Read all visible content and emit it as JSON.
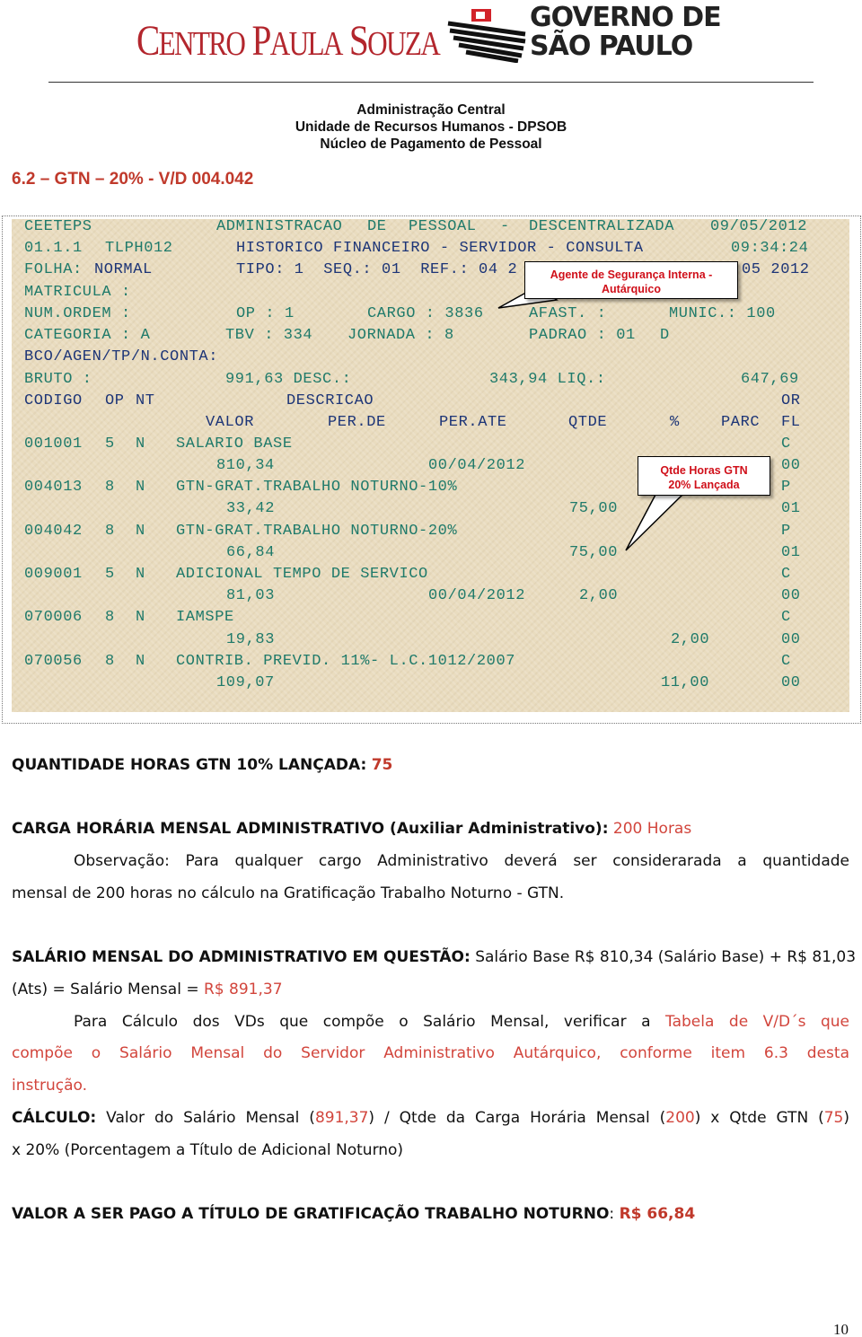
{
  "logos": {
    "left": "Centro Paula Souza",
    "right_line1": "GOVERNO DE",
    "right_line2": "SÃO PAULO"
  },
  "header": {
    "line1": "Administração Central",
    "line2": "Unidade de Recursos Humanos - DPSOB",
    "line3": "Núcleo de Pagamento de Pessoal"
  },
  "section_title": "6.2 – GTN – 20% - V/D 004.042",
  "terminal": {
    "rows": [
      [
        {
          "t": "CEETEPS",
          "c": "teal"
        },
        {
          "t": "ADMINISTRACAO",
          "c": "teal"
        },
        {
          "t": "DE",
          "c": "teal"
        },
        {
          "t": "PESSOAL",
          "c": "teal"
        },
        {
          "t": "-",
          "c": "teal"
        },
        {
          "t": "DESCENTRALIZADA",
          "c": "teal"
        },
        {
          "t": "09/05/2012",
          "c": "teal"
        }
      ],
      [
        {
          "t": "01.1.1",
          "c": "teal"
        },
        {
          "t": "TLPH012",
          "c": "teal"
        },
        {
          "t": "HISTORICO FINANCEIRO - SERVIDOR - CONSULTA",
          "c": "navy"
        },
        {
          "t": "09:34:24",
          "c": "teal"
        }
      ],
      [
        {
          "t": "FOLHA:",
          "c": "teal"
        },
        {
          "t": "NORMAL",
          "c": "navy"
        },
        {
          "t": "TIPO: 1  SEQ.: 01  REF.: 04 2",
          "c": "navy"
        },
        {
          "t": "05 2012",
          "c": "navy"
        }
      ],
      [
        {
          "t": "MATRICULA :",
          "c": "teal"
        }
      ],
      [
        {
          "t": "NUM.ORDEM :",
          "c": "teal"
        },
        {
          "t": "OP : 1",
          "c": "teal"
        },
        {
          "t": "CARGO : 3836",
          "c": "teal"
        },
        {
          "t": "AFAST. :",
          "c": "teal"
        },
        {
          "t": "MUNIC.: 100",
          "c": "teal"
        }
      ],
      [
        {
          "t": "CATEGORIA : A",
          "c": "teal"
        },
        {
          "t": "TBV : 334",
          "c": "teal"
        },
        {
          "t": "JORNADA : 8",
          "c": "teal"
        },
        {
          "t": "PADRAO : 01",
          "c": "teal"
        },
        {
          "t": "D",
          "c": "teal"
        }
      ],
      [
        {
          "t": "BCO/AGEN/TP/N.CONTA:",
          "c": "navy"
        }
      ],
      [
        {
          "t": "BRUTO :",
          "c": "teal"
        },
        {
          "t": "991,63 DESC.:",
          "c": "teal"
        },
        {
          "t": "343,94 LIQ.:",
          "c": "teal"
        },
        {
          "t": "647,69",
          "c": "teal"
        }
      ],
      [
        {
          "t": "CODIGO",
          "c": "navy"
        },
        {
          "t": "OP",
          "c": "navy"
        },
        {
          "t": "NT",
          "c": "navy"
        },
        {
          "t": "DESCRICAO",
          "c": "navy"
        },
        {
          "t": "OR",
          "c": "navy"
        }
      ],
      [
        {
          "t": "VALOR",
          "c": "navy"
        },
        {
          "t": "PER.DE",
          "c": "navy"
        },
        {
          "t": "PER.ATE",
          "c": "navy"
        },
        {
          "t": "QTDE",
          "c": "navy"
        },
        {
          "t": "%",
          "c": "navy"
        },
        {
          "t": "PARC",
          "c": "navy"
        },
        {
          "t": "FL",
          "c": "navy"
        }
      ],
      [
        {
          "t": "001001",
          "c": "teal"
        },
        {
          "t": "5",
          "c": "teal"
        },
        {
          "t": "N",
          "c": "teal"
        },
        {
          "t": "SALARIO BASE",
          "c": "teal"
        },
        {
          "t": "C",
          "c": "teal"
        }
      ],
      [
        {
          "t": "810,34",
          "c": "teal"
        },
        {
          "t": "00/04/2012",
          "c": "teal"
        },
        {
          "t": "00",
          "c": "teal"
        }
      ],
      [
        {
          "t": "004013",
          "c": "teal"
        },
        {
          "t": "8",
          "c": "teal"
        },
        {
          "t": "N",
          "c": "teal"
        },
        {
          "t": "GTN-GRAT.TRABALHO NOTURNO-10%",
          "c": "teal"
        },
        {
          "t": "P",
          "c": "teal"
        }
      ],
      [
        {
          "t": "33,42",
          "c": "teal"
        },
        {
          "t": "75,00",
          "c": "teal"
        },
        {
          "t": "01",
          "c": "teal"
        }
      ],
      [
        {
          "t": "004042",
          "c": "teal"
        },
        {
          "t": "8",
          "c": "teal"
        },
        {
          "t": "N",
          "c": "teal"
        },
        {
          "t": "GTN-GRAT.TRABALHO NOTURNO-20%",
          "c": "teal"
        },
        {
          "t": "P",
          "c": "teal"
        }
      ],
      [
        {
          "t": "66,84",
          "c": "teal"
        },
        {
          "t": "75,00",
          "c": "teal"
        },
        {
          "t": "01",
          "c": "teal"
        }
      ],
      [
        {
          "t": "009001",
          "c": "teal"
        },
        {
          "t": "5",
          "c": "teal"
        },
        {
          "t": "N",
          "c": "teal"
        },
        {
          "t": "ADICIONAL TEMPO DE SERVICO",
          "c": "teal"
        },
        {
          "t": "C",
          "c": "teal"
        }
      ],
      [
        {
          "t": "81,03",
          "c": "teal"
        },
        {
          "t": "00/04/2012",
          "c": "teal"
        },
        {
          "t": "2,00",
          "c": "teal"
        },
        {
          "t": "00",
          "c": "teal"
        }
      ],
      [
        {
          "t": "070006",
          "c": "teal"
        },
        {
          "t": "8",
          "c": "teal"
        },
        {
          "t": "N",
          "c": "teal"
        },
        {
          "t": "IAMSPE",
          "c": "teal"
        },
        {
          "t": "C",
          "c": "teal"
        }
      ],
      [
        {
          "t": "19,83",
          "c": "teal"
        },
        {
          "t": "2,00",
          "c": "teal"
        },
        {
          "t": "00",
          "c": "teal"
        }
      ],
      [
        {
          "t": "070056",
          "c": "teal"
        },
        {
          "t": "8",
          "c": "teal"
        },
        {
          "t": "N",
          "c": "teal"
        },
        {
          "t": "CONTRIB. PREVID. 11%- L.C.1012/2007",
          "c": "teal"
        },
        {
          "t": "C",
          "c": "teal"
        }
      ],
      [
        {
          "t": "109,07",
          "c": "teal"
        },
        {
          "t": "11,00",
          "c": "teal"
        },
        {
          "t": "00",
          "c": "teal"
        }
      ]
    ],
    "callout1_l1": "Agente de Segurança Interna -",
    "callout1_l2": "Autárquico",
    "callout2_l1": "Qtde Horas GTN",
    "callout2_l2": "20% Lançada"
  },
  "body": {
    "qtd_label": "QUANTIDADE HORAS GTN 10% LANÇADA:",
    "qtd_value": "75",
    "carga_label": "CARGA HORÁRIA MENSAL ADMINISTRATIVO (Auxiliar Administrativo):",
    "carga_value": "200 Horas",
    "obs_line1": "Observação: Para qualquer cargo Administrativo deverá ser considerarada a quantidade",
    "obs_line2": "mensal de 200 horas no cálculo na Gratificação Trabalho Noturno - GTN.",
    "sal_label": "SALÁRIO MENSAL DO ADMINISTRATIVO EM QUESTÃO:",
    "sal_text1": "Salário Base R$ 810,34 (Salário Base) + R$ 81,03",
    "sal_text2": "(Ats) = Salário Mensal =",
    "sal_value": "R$ 891,37",
    "para_l1_a": "Para Cálculo dos VDs que compõe o Salário Mensal, verificar a",
    "para_l1_b": "Tabela de V/D´s que",
    "para_l2": "compõe o Salário Mensal do Servidor Administrativo Autárquico, conforme item 6.3 desta",
    "para_l3": "instrução.",
    "calc_label": "CÁLCULO:",
    "calc_t1": "Valor do Salário Mensal (",
    "calc_v1": "891,37",
    "calc_t2": ") / Qtde da Carga Horária Mensal (",
    "calc_v2": "200",
    "calc_t3": ") x Qtde GTN (",
    "calc_v3": "75",
    "calc_t4": ")",
    "calc_line2": "x 20% (Porcentagem a Título de Adicional Noturno)",
    "valor_label": "VALOR A SER PAGO A TÍTULO DE GRATIFICAÇÃO TRABALHO NOTURNO",
    "valor_sep": ":",
    "valor_value": "R$ 66,84"
  },
  "page_number": "10",
  "colors": {
    "teal": "#1f7a6a",
    "navy": "#1d3577",
    "red": "#c0392b",
    "terminal_bg": "#e9dcbf"
  }
}
